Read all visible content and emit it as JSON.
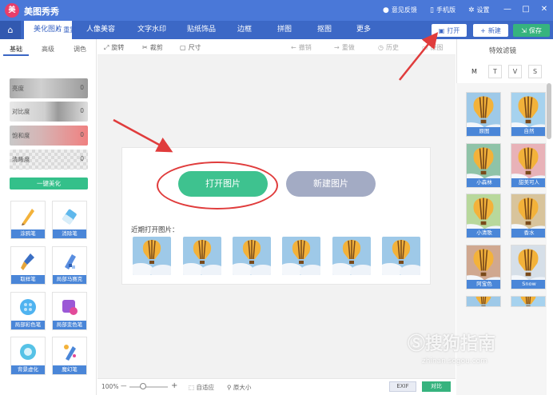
{
  "window": {
    "logo": "美",
    "title": "美图秀秀",
    "links": [
      {
        "label": "意见反馈",
        "icon": "chat-icon"
      },
      {
        "label": "手机版",
        "icon": "phone-icon"
      },
      {
        "label": "设置",
        "icon": "gear-icon"
      }
    ],
    "controls": [
      "—",
      "□",
      "✕"
    ]
  },
  "nav": {
    "home_icon": "⌂",
    "tabs": [
      "美化图片",
      "人像美容",
      "文字水印",
      "贴纸饰品",
      "边框",
      "拼图",
      "抠图",
      "更多"
    ],
    "active_tab": 0,
    "open_label": "打开",
    "new_label": "新建",
    "save_label": "保存"
  },
  "left": {
    "subtabs": [
      "基础",
      "高级",
      "调色"
    ],
    "reset_label": "重置",
    "sliders": [
      {
        "label": "亮度",
        "value": "0"
      },
      {
        "label": "对比度",
        "value": "0"
      },
      {
        "label": "饱和度",
        "value": "0"
      },
      {
        "label": "清晰度",
        "value": "0"
      }
    ],
    "one_key_label": "一键美化",
    "tools": [
      "涂鸦笔",
      "消除笔",
      "取样笔",
      "局部马赛克",
      "局部彩色笔",
      "局部变色笔",
      "背景虚化",
      "魔幻笔"
    ]
  },
  "toolbar": {
    "rotate": "旋转",
    "crop": "裁剪",
    "size": "尺寸",
    "undo": "撤销",
    "redo": "重做",
    "history": "历史",
    "original": "原图"
  },
  "canvas": {
    "open_button": "打开图片",
    "new_button": "新建图片",
    "recent_label": "近期打开图片：",
    "recent_count": 6
  },
  "status": {
    "zoom": "100%",
    "fit": "自适应",
    "original_size": "原大小",
    "exif": "EXIF",
    "compare": "对比"
  },
  "right": {
    "title": "特效滤镜",
    "filter_tabs": [
      "M",
      "T",
      "V",
      "S"
    ],
    "filters": [
      "原图",
      "自然",
      "小森林",
      "甜美可人",
      "小清歌",
      "香水",
      "阿宝色",
      "Snow",
      "",
      ""
    ]
  },
  "watermark": {
    "text": "搜狗指南",
    "sub": "zhinan.sogou.com"
  },
  "colors": {
    "title_bar": "#4a78d8",
    "accent_green": "#3ec28f",
    "annotation_red": "#e03c3c"
  }
}
